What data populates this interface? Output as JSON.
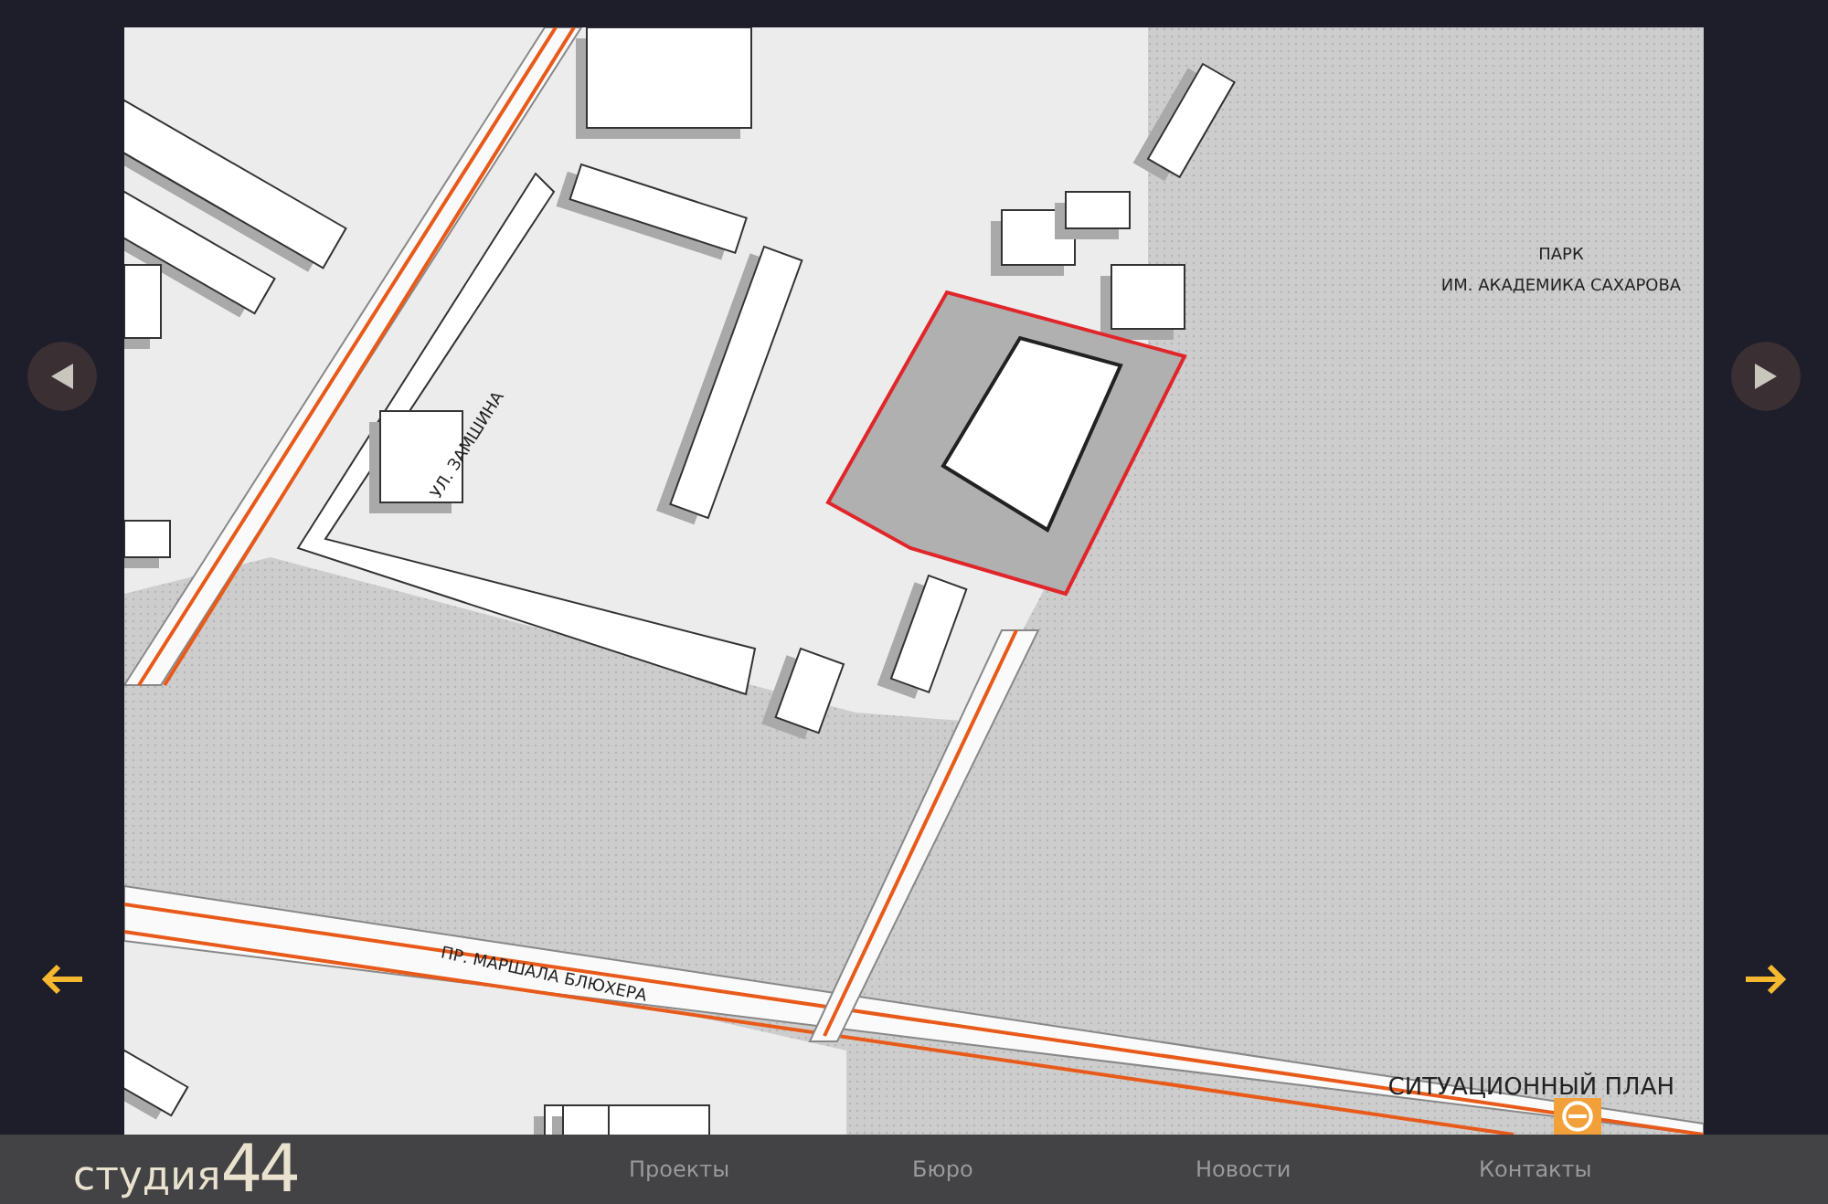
{
  "map": {
    "labels": [
      {
        "kind": "park",
        "text": "ПАРК"
      },
      {
        "kind": "park",
        "text": "ИМ. АКАДЕМИКА САХАРОВА"
      },
      {
        "kind": "street_a",
        "text": "УЛ. ЗАМШИНА"
      },
      {
        "kind": "street_b",
        "text": "ПР. МАРШАЛА БЛЮХЕРА"
      },
      {
        "kind": "caption",
        "text": "СИТУАЦИОННЫЙ ПЛАН"
      }
    ]
  },
  "footer": {
    "logo_word": "студия",
    "logo_number": "44",
    "nav": [
      "Проекты",
      "Бюро",
      "Новости",
      "Контакты"
    ]
  }
}
